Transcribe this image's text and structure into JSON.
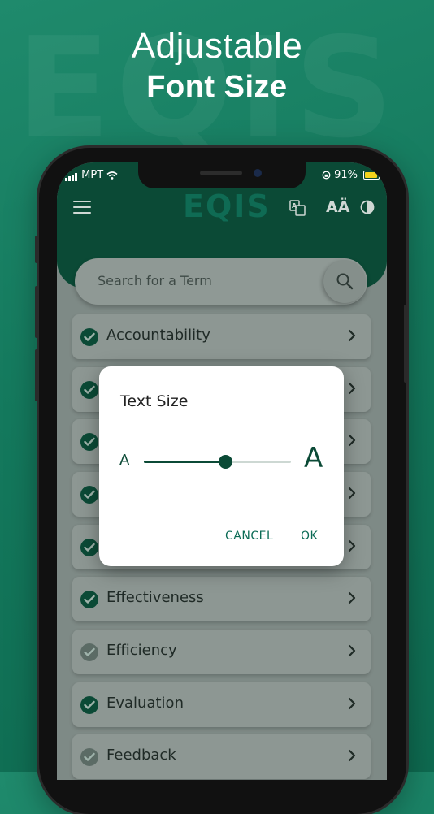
{
  "promo": {
    "line1": "Adjustable",
    "line2": "Font Size",
    "watermark": "EQIS"
  },
  "status_bar": {
    "carrier": "MPT",
    "battery_percent": "91%",
    "battery_level": 0.91,
    "battery_color": "#f3d31d"
  },
  "app": {
    "logo": "EQIS",
    "translate_icon": "translate-icon",
    "font_size_icon_label": "AÄ",
    "contrast_icon": "contrast-icon",
    "search_placeholder": "Search for a Term"
  },
  "terms": [
    {
      "label": "Accountability",
      "checked": true
    },
    {
      "label": "",
      "checked": true
    },
    {
      "label": "",
      "checked": true
    },
    {
      "label": "",
      "checked": true
    },
    {
      "label": "",
      "checked": true
    },
    {
      "label": "Effectiveness",
      "checked": true
    },
    {
      "label": "Efficiency",
      "checked": false
    },
    {
      "label": "Evaluation",
      "checked": true
    },
    {
      "label": "Feedback",
      "checked": false
    }
  ],
  "dialog": {
    "title": "Text Size",
    "small_a": "A",
    "large_a": "A",
    "slider_value": 0.55,
    "cancel": "CANCEL",
    "ok": "OK"
  },
  "colors": {
    "brand_dark": "#0b4a36",
    "background": "#1a8164",
    "accent": "#0b6b55"
  }
}
